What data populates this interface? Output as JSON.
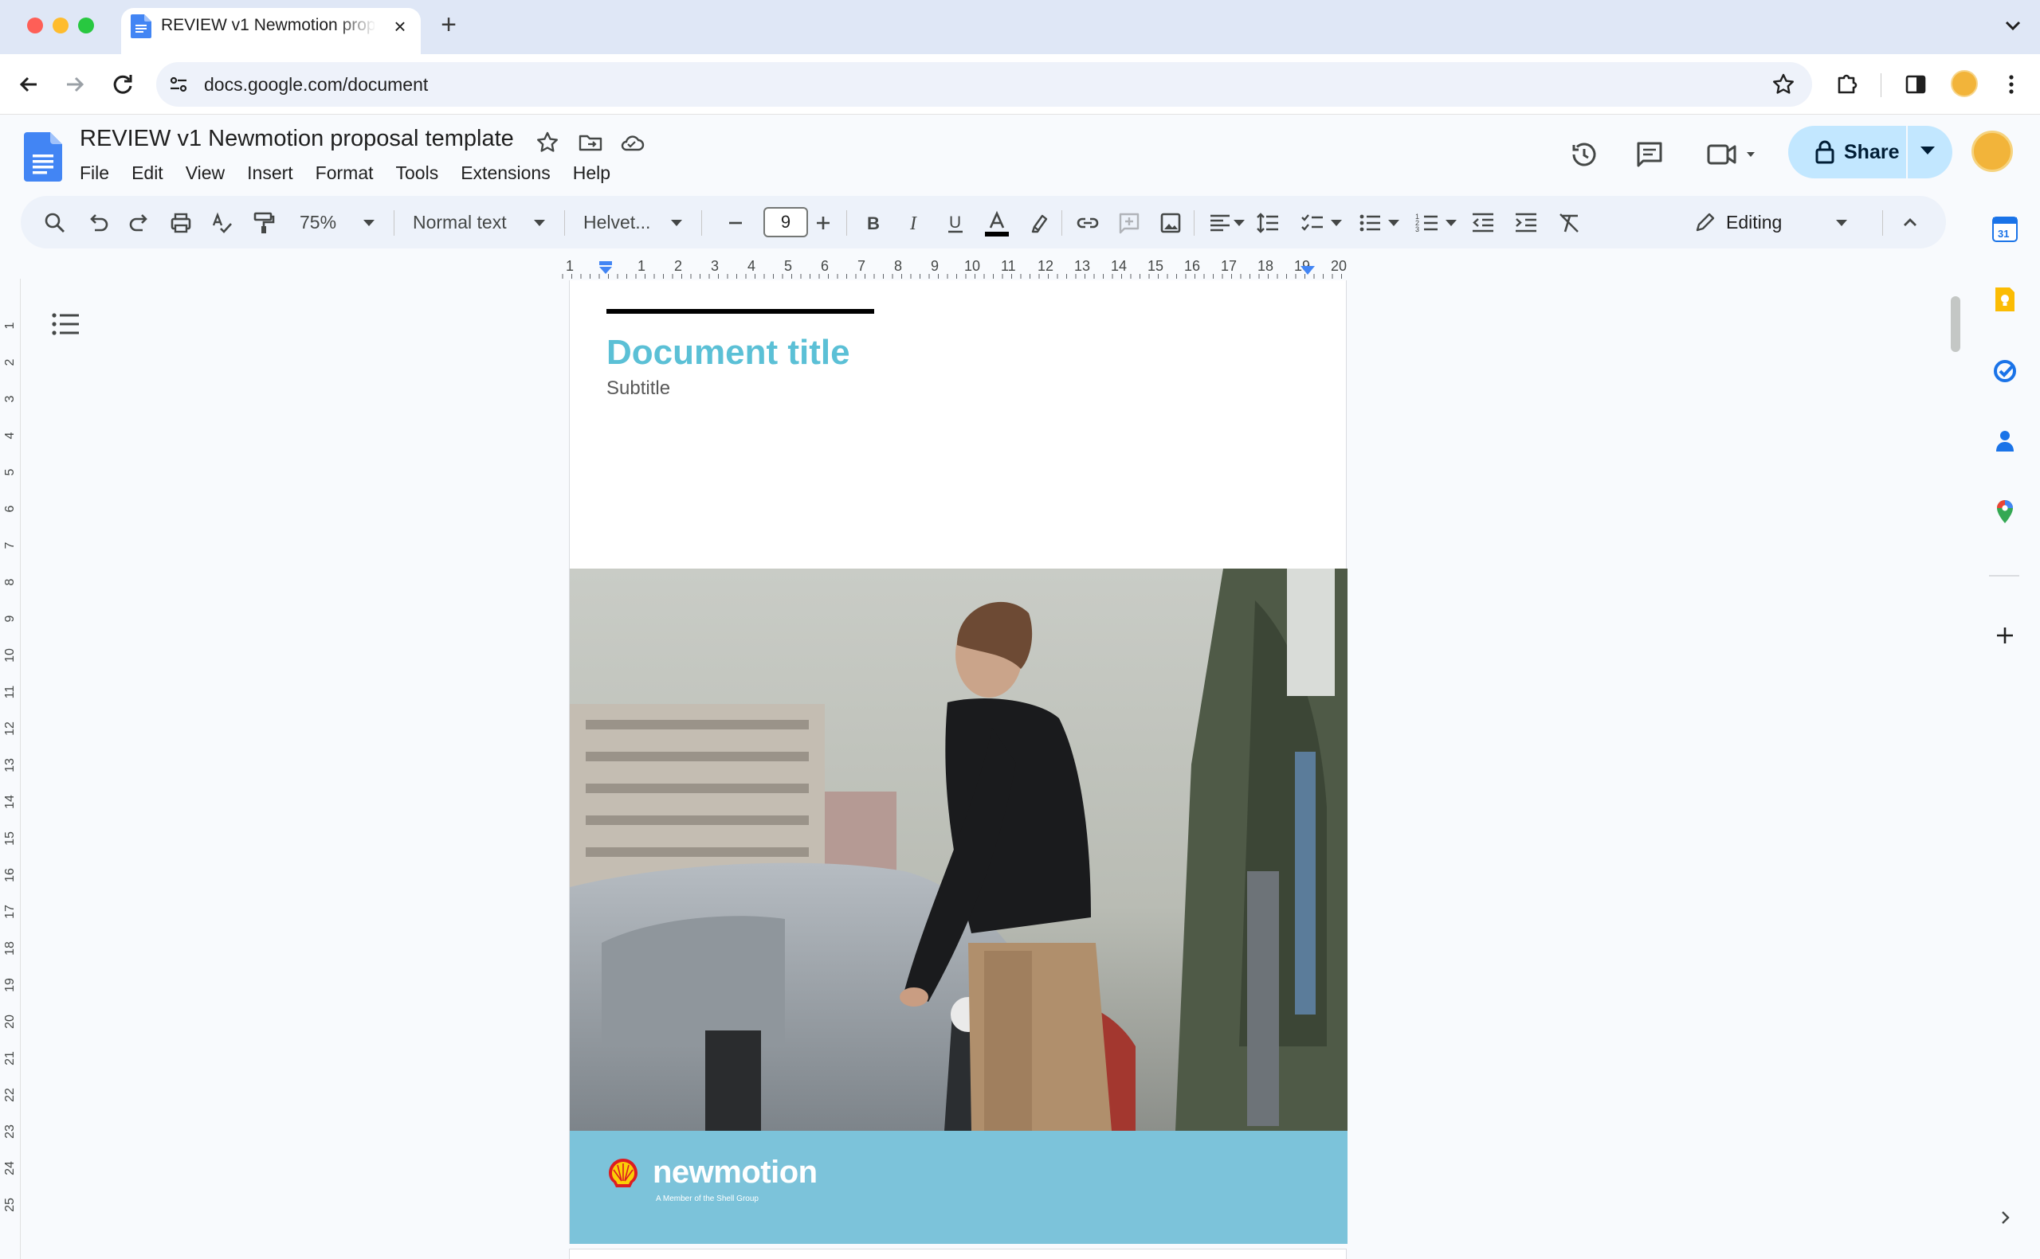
{
  "browser": {
    "tab_title": "REVIEW v1 Newmotion proposal template",
    "url": "docs.google.com/document"
  },
  "doc": {
    "title": "REVIEW v1 Newmotion proposal template",
    "menu": [
      "File",
      "Edit",
      "View",
      "Insert",
      "Format",
      "Tools",
      "Extensions",
      "Help"
    ],
    "share_label": "Share"
  },
  "toolbar": {
    "zoom": "75%",
    "style": "Normal text",
    "font": "Helvet...",
    "font_size": "9",
    "mode": "Editing"
  },
  "ruler": {
    "horizontal": [
      "1",
      "1",
      "2",
      "3",
      "4",
      "5",
      "6",
      "7",
      "8",
      "9",
      "10",
      "11",
      "12",
      "13",
      "14",
      "15",
      "16",
      "17",
      "18",
      "19",
      "20"
    ],
    "vertical": [
      "1",
      "2",
      "3",
      "4",
      "5",
      "6",
      "7",
      "8",
      "9",
      "10",
      "11",
      "12",
      "13",
      "14",
      "15",
      "16",
      "17",
      "18",
      "19",
      "20",
      "21",
      "22",
      "23",
      "24",
      "25"
    ]
  },
  "page": {
    "heading": "Document title",
    "subtitle": "Subtitle",
    "brand_name": "newmotion",
    "brand_tagline": "A Member of the Shell Group"
  },
  "colors": {
    "heading": "#5bc0d6",
    "brand_band": "#7cc3da",
    "share_button": "#c2e7ff",
    "toolbar_bg": "#edf2fa"
  }
}
